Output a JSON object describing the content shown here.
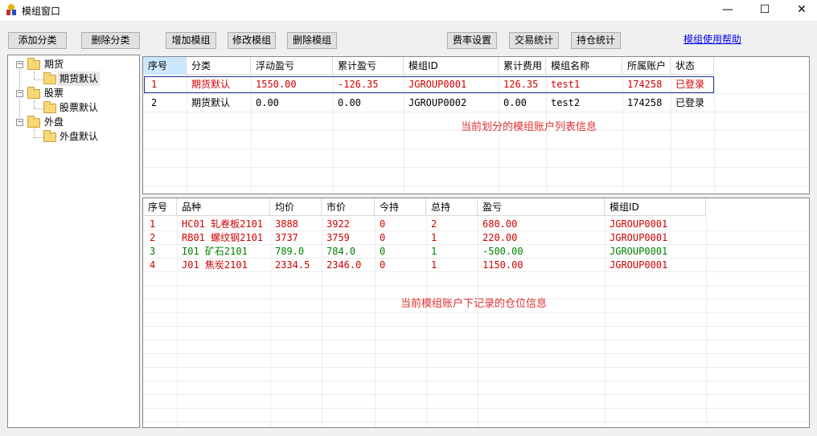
{
  "window": {
    "title": "模组窗口",
    "minimize_glyph": "—",
    "maximize_glyph": "☐",
    "close_glyph": "✕"
  },
  "toolbar": {
    "add_category": "添加分类",
    "delete_category": "删除分类",
    "add_module": "增加模组",
    "edit_module": "修改模组",
    "delete_module": "删除模组",
    "fee_settings": "费率设置",
    "trade_stats": "交易统计",
    "position_stats": "持仓统计",
    "help_link": "模组使用帮助"
  },
  "tree": {
    "nodes": [
      {
        "label": "期货",
        "expander": "−"
      },
      {
        "label": "期货默认"
      },
      {
        "label": "股票",
        "expander": "−"
      },
      {
        "label": "股票默认"
      },
      {
        "label": "外盘",
        "expander": "−"
      },
      {
        "label": "外盘默认"
      }
    ],
    "selected": "期货默认"
  },
  "accounts_grid": {
    "columns": [
      "序号",
      "分类",
      "浮动盈亏",
      "累计盈亏",
      "模组ID",
      "累计费用",
      "模组名称",
      "所属账户",
      "状态"
    ],
    "rows": [
      {
        "no": "1",
        "category": "期货默认",
        "float_pl": "1550.00",
        "total_pl": "-126.35",
        "module_id": "JGROUP0001",
        "fees": "126.35",
        "name": "test1",
        "account": "174258",
        "status": "已登录",
        "color": "#d00000"
      },
      {
        "no": "2",
        "category": "期货默认",
        "float_pl": "0.00",
        "total_pl": "0.00",
        "module_id": "JGROUP0002",
        "fees": "0.00",
        "name": "test2",
        "account": "174258",
        "status": "已登录",
        "color": "#000000"
      }
    ],
    "hint": "当前划分的模组账户列表信息"
  },
  "positions_grid": {
    "columns": [
      "序号",
      "品种",
      "均价",
      "市价",
      "今持",
      "总持",
      "盈亏",
      "模组ID"
    ],
    "rows": [
      {
        "no": "1",
        "symbol": "HC01 轧卷板2101",
        "avg": "3888",
        "market": "3922",
        "today": "0",
        "total": "2",
        "pl": "680.00",
        "module_id": "JGROUP0001",
        "color": "#d00000"
      },
      {
        "no": "2",
        "symbol": "RB01 螺纹钢2101",
        "avg": "3737",
        "market": "3759",
        "today": "0",
        "total": "1",
        "pl": "220.00",
        "module_id": "JGROUP0001",
        "color": "#d00000"
      },
      {
        "no": "3",
        "symbol": "I01 矿石2101",
        "avg": "789.0",
        "market": "784.0",
        "today": "0",
        "total": "1",
        "pl": "-500.00",
        "module_id": "JGROUP0001",
        "color": "#008000"
      },
      {
        "no": "4",
        "symbol": "J01 焦炭2101",
        "avg": "2334.5",
        "market": "2346.0",
        "today": "0",
        "total": "1",
        "pl": "1150.00",
        "module_id": "JGROUP0001",
        "color": "#d00000"
      }
    ],
    "hint": "当前模组账户下记录的仓位信息"
  },
  "colors": {
    "accent_red": "#e03030",
    "profit": "#d00000",
    "loss": "#008000",
    "selection_border": "#1e2fa0",
    "header_selected": "#cce8ff"
  }
}
